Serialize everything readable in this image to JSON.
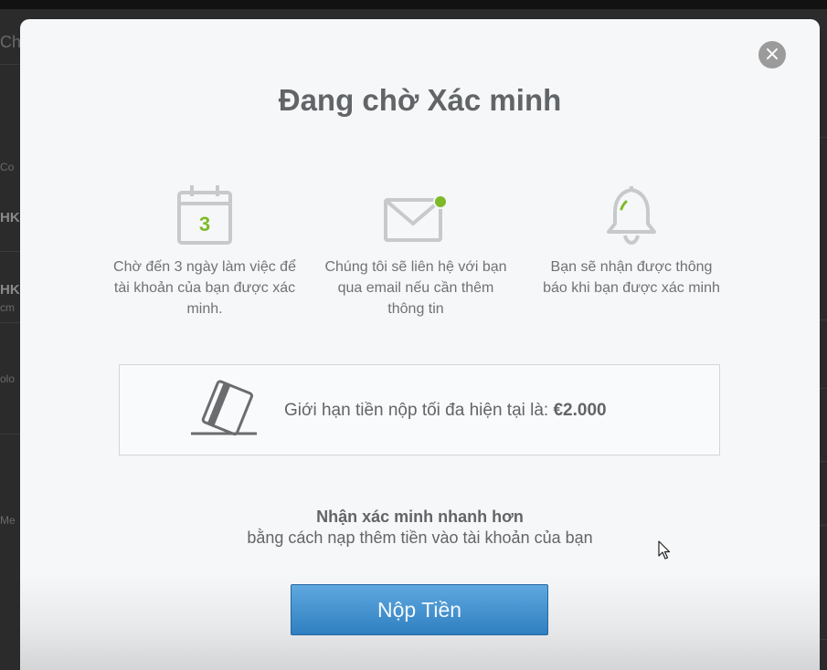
{
  "background": {
    "fragments": [
      "Ch",
      "Co",
      "HK",
      "HK",
      "cm",
      "olo",
      "Me"
    ]
  },
  "modal": {
    "close_glyph": "×",
    "title": "Đang chờ Xác minh",
    "steps": [
      {
        "icon": "calendar-icon",
        "badge": "3",
        "text": "Chờ đến 3 ngày làm việc để tài khoản của bạn được xác minh."
      },
      {
        "icon": "envelope-notification-icon",
        "text": "Chúng tôi sẽ liên hệ với bạn qua email nếu cần thêm thông tin"
      },
      {
        "icon": "bell-icon",
        "text": "Bạn sẽ nhận được thông báo khi bạn được xác minh"
      }
    ],
    "limit": {
      "icon": "card-icon",
      "label": "Giới hạn tiền nộp tối đa hiện tại là: ",
      "amount": "€2.000"
    },
    "promo": {
      "title": "Nhận xác minh nhanh hơn",
      "subtitle": "bằng cách nạp thêm tiền vào tài khoản của bạn"
    },
    "deposit_button": "Nộp Tiền"
  },
  "colors": {
    "accent_green": "#7dba2a",
    "button_blue": "#3b8dcf",
    "icon_gray": "#c8c9cb",
    "text_gray": "#626568"
  }
}
